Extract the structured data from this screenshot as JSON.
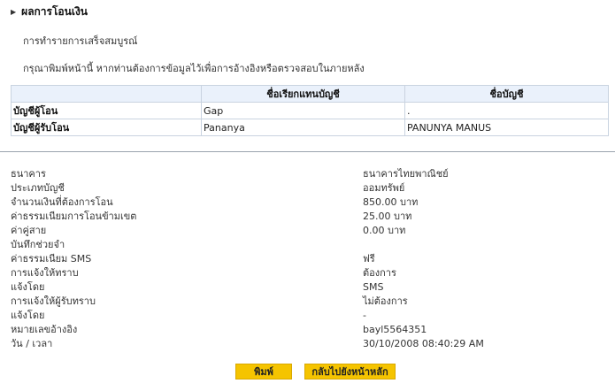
{
  "section": {
    "title": "ผลการโอนเงิน"
  },
  "messages": {
    "success": "การทำรายการเสร็จสมบูรณ์",
    "print_hint": "กรุณาพิมพ์หน้านี้ หากท่านต้องการข้อมูลไว้เพื่อการอ้างอิงหรือตรวจสอบในภายหลัง"
  },
  "accounts_table": {
    "headers": [
      "",
      "ชื่อเรียกแทนบัญชี",
      "ชื่อบัญชี"
    ],
    "rows": [
      {
        "label": "บัญชีผู้โอน",
        "nickname": "Gap",
        "account_name": "."
      },
      {
        "label": "บัญชีผู้รับโอน",
        "nickname": "Pananya",
        "account_name": "PANUNYA MANUS"
      }
    ]
  },
  "details": [
    {
      "label": "ธนาคาร",
      "value": "ธนาคารไทยพาณิชย์"
    },
    {
      "label": "ประเภทบัญชี",
      "value": "ออมทรัพย์"
    },
    {
      "label": "จำนวนเงินที่ต้องการโอน",
      "value": "850.00 บาท"
    },
    {
      "label": "ค่าธรรมเนียมการโอนข้ามเขต",
      "value": "25.00 บาท"
    },
    {
      "label": "ค่าคู่สาย",
      "value": "0.00 บาท"
    },
    {
      "label": "บันทึกช่วยจำ",
      "value": ""
    },
    {
      "label": "ค่าธรรมเนียม SMS",
      "value": "ฟรี"
    },
    {
      "label": "การแจ้งให้ทราบ",
      "value": "ต้องการ"
    },
    {
      "label": "แจ้งโดย",
      "value": "SMS"
    },
    {
      "label": "การแจ้งให้ผู้รับทราบ",
      "value": "ไม่ต้องการ"
    },
    {
      "label": "แจ้งโดย",
      "value": "-"
    },
    {
      "label": "หมายเลขอ้างอิง",
      "value": "bayl5564351"
    },
    {
      "label": "วัน / เวลา",
      "value": "30/10/2008 08:40:29 AM"
    }
  ],
  "buttons": {
    "print": "พิมพ์",
    "back_home": "กลับไปยังหน้าหลัก"
  },
  "colors": {
    "button_bg": "#f5c400",
    "table_header_bg": "#eaf1fb",
    "table_border": "#c9d3e0"
  }
}
